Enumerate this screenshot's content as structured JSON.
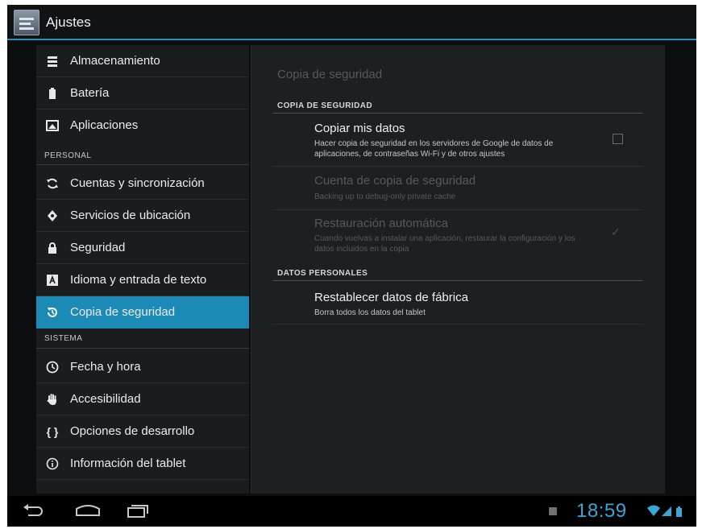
{
  "app": {
    "title": "Ajustes",
    "icon": "settings-app-icon"
  },
  "sidebar": {
    "items": [
      {
        "label": "Almacenamiento",
        "icon": "storage-icon"
      },
      {
        "label": "Batería",
        "icon": "battery-icon"
      },
      {
        "label": "Aplicaciones",
        "icon": "apps-icon"
      },
      {
        "label": "Cuentas y sincronización",
        "icon": "sync-icon"
      },
      {
        "label": "Servicios de ubicación",
        "icon": "location-icon"
      },
      {
        "label": "Seguridad",
        "icon": "lock-icon"
      },
      {
        "label": "Idioma y entrada de texto",
        "icon": "language-icon"
      },
      {
        "label": "Copia de seguridad",
        "icon": "backup-icon",
        "selected": true
      },
      {
        "label": "Fecha y hora",
        "icon": "clock-icon"
      },
      {
        "label": "Accesibilidad",
        "icon": "hand-icon"
      },
      {
        "label": "Opciones de desarrollo",
        "icon": "braces-icon"
      },
      {
        "label": "Información del tablet",
        "icon": "info-icon"
      }
    ],
    "sections": {
      "personal": "PERSONAL",
      "sistema": "SISTEMA"
    }
  },
  "detail": {
    "title": "Copia de seguridad",
    "header_backup": "COPIA DE SEGURIDAD",
    "copy_data": {
      "title": "Copiar mis datos",
      "summary": "Hacer copia de seguridad en los servidores de Google de datos de aplicaciones, de contraseñas Wi-Fi y de otros ajustes",
      "checked": false
    },
    "backup_account": {
      "title": "Cuenta de copia de seguridad",
      "summary": "Backing up to debug-only private cache",
      "enabled": false
    },
    "auto_restore": {
      "title": "Restauración automática",
      "summary": "Cuando vuelvas a instalar una aplicación, restaurar la configuración y los datos incluidos en la copia",
      "checked": true,
      "enabled": false
    },
    "header_personal": "DATOS PERSONALES",
    "factory_reset": {
      "title": "Restablecer datos de fábrica",
      "summary": "Borra todos los datos del tablet"
    }
  },
  "navbar": {
    "time": "18:59",
    "accent": "#33b5e5"
  },
  "colors": {
    "selection": "#1b8ab6",
    "accent_line": "#2a8fb8"
  }
}
